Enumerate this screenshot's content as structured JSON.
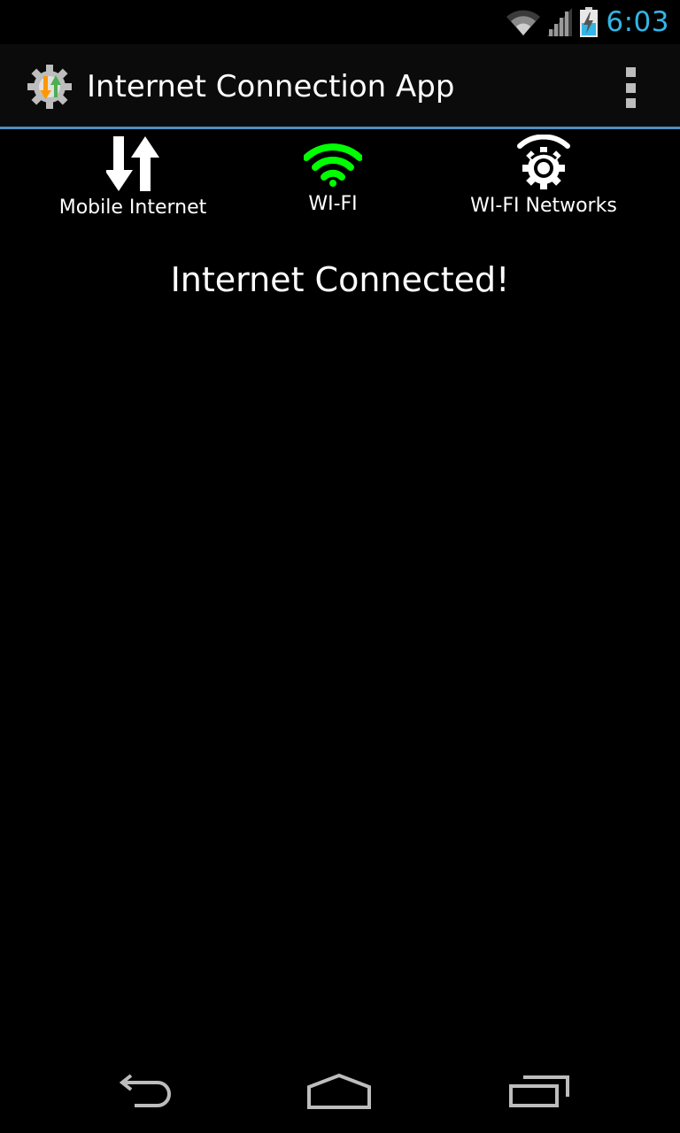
{
  "status_bar": {
    "time": "6:03",
    "icons": [
      "wifi-icon",
      "cell-signal-icon",
      "battery-charging-icon"
    ],
    "time_color": "#33b5e5"
  },
  "action_bar": {
    "title": "Internet Connection App",
    "app_icon": "gear-arrows-icon",
    "overflow_icon": "overflow-menu-icon",
    "underline_color": "#4f8dbf"
  },
  "tools": {
    "mobile": {
      "label": "Mobile Internet",
      "icon": "up-down-arrows-icon"
    },
    "wifi": {
      "label": "WI-FI",
      "icon": "wifi-icon",
      "color": "#00ff00"
    },
    "networks": {
      "label": "WI-FI Networks",
      "icon": "wifi-gear-icon"
    }
  },
  "main": {
    "message": "Internet Connected!"
  },
  "nav_bar": {
    "buttons": [
      "back-icon",
      "home-icon",
      "recent-apps-icon"
    ]
  }
}
